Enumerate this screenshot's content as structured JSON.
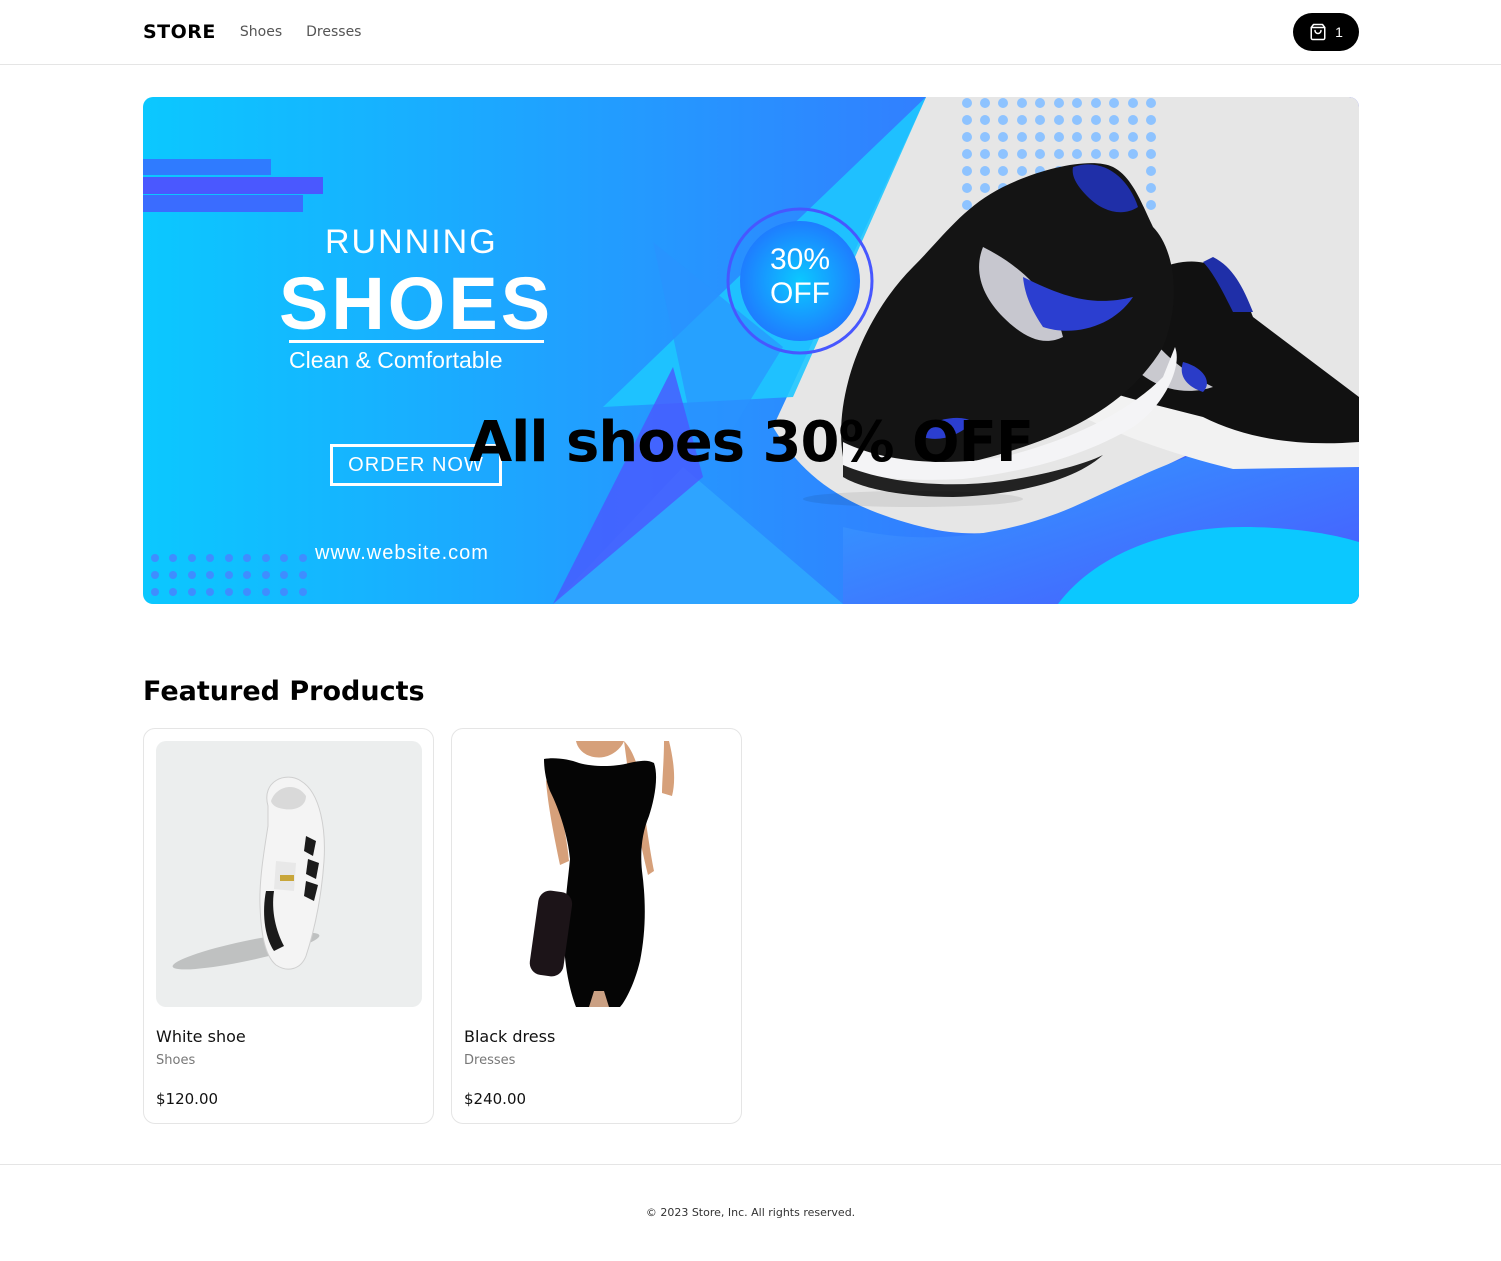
{
  "header": {
    "brand": "STORE",
    "nav": [
      "Shoes",
      "Dresses"
    ],
    "cart_count": "1"
  },
  "billboard": {
    "label": "All shoes 30% OFF",
    "image": {
      "line1": "RUNNING",
      "line2": "SHOES",
      "tagline": "Clean & Comfortable",
      "cta": "ORDER NOW",
      "website": "www.website.com",
      "discount": "30% OFF",
      "colors": {
        "primary": "#1e90ff",
        "accent": "#0bc8ff",
        "deep": "#4757ff"
      }
    }
  },
  "featured": {
    "title": "Featured Products",
    "products": [
      {
        "name": "White shoe",
        "category": "Shoes",
        "price": "$120.00"
      },
      {
        "name": "Black dress",
        "category": "Dresses",
        "price": "$240.00"
      }
    ]
  },
  "footer": {
    "copyright": "© 2023 Store, Inc. All rights reserved."
  }
}
